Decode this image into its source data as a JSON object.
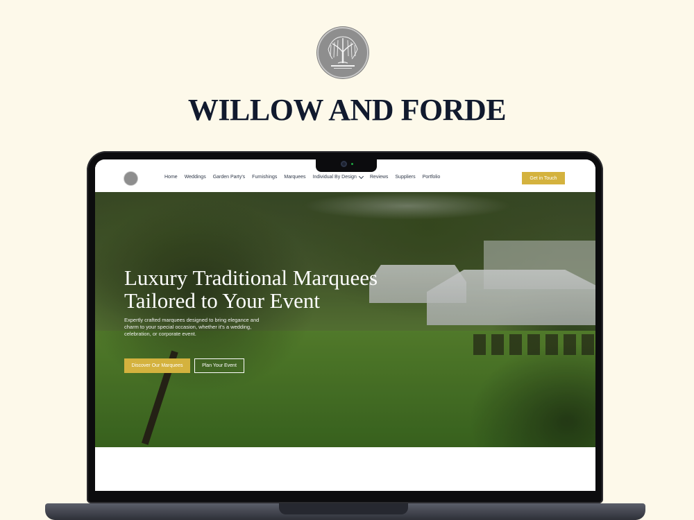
{
  "brand": {
    "title": "WILLOW AND FORDE",
    "logo_icon": "willow-tree-icon",
    "logo_text": "WILLOW & FORDE"
  },
  "nav": {
    "links": [
      "Home",
      "Weddings",
      "Garden Party's",
      "Furnishings",
      "Marquees",
      "Individual By Design",
      "Reviews",
      "Suppliers",
      "Portfolio"
    ],
    "cta": "Get in Touch"
  },
  "hero": {
    "title_line1": "Luxury Traditional Marquees",
    "title_line2": "Tailored to Your Event",
    "subtitle": "Expertly crafted marquees designed to bring elegance and charm to your special occasion, whether it's a wedding, celebration, or corporate event.",
    "primary_button": "Discover Our Marquees",
    "secondary_button": "Plan Your Event"
  },
  "colors": {
    "background": "#fdf9ea",
    "accent": "#d4b23e",
    "title": "#111a2e"
  }
}
